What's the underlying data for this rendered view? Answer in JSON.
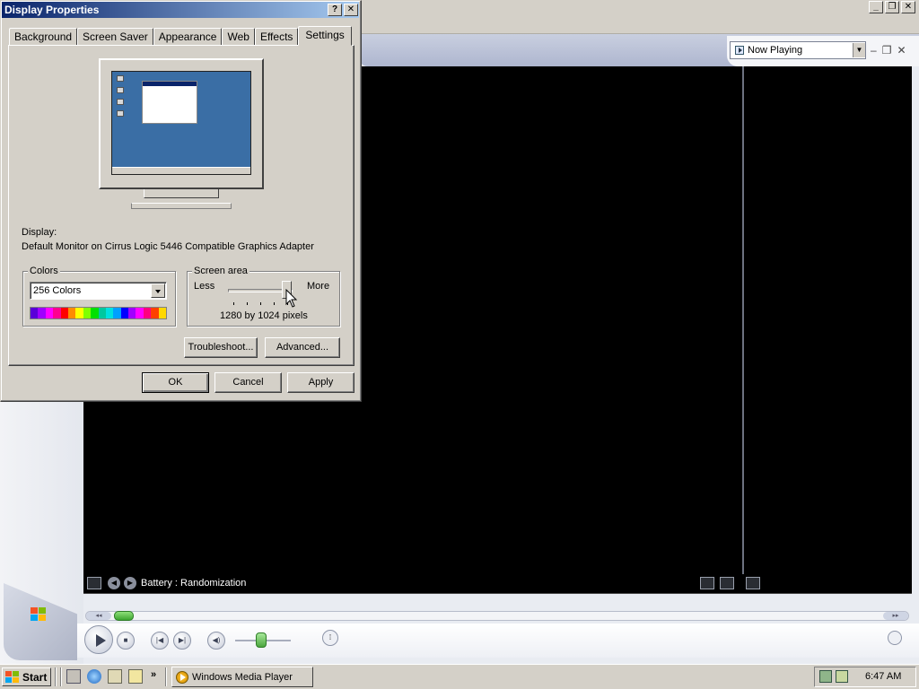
{
  "dialog": {
    "title": "Display Properties",
    "tabs": [
      "Background",
      "Screen Saver",
      "Appearance",
      "Web",
      "Effects",
      "Settings"
    ],
    "active_tab": "Settings",
    "display_label": "Display:",
    "display_value": "Default Monitor on Cirrus Logic 5446 Compatible Graphics Adapter",
    "colors": {
      "legend": "Colors",
      "selected": "256 Colors",
      "palette": [
        "#5a00d8",
        "#a000ff",
        "#ff00ff",
        "#ff0090",
        "#ff0000",
        "#ff8c00",
        "#ffff00",
        "#80ff00",
        "#00e000",
        "#00c8a0",
        "#00e0e0",
        "#00a0ff",
        "#0000ff",
        "#a000ff",
        "#ff00ff",
        "#ff0080",
        "#ff4000",
        "#ffd800"
      ]
    },
    "screen_area": {
      "legend": "Screen area",
      "less_label": "Less",
      "more_label": "More",
      "resolution_text": "1280 by 1024 pixels",
      "slider_level": 0.85
    },
    "buttons": {
      "troubleshoot": "Troubleshoot...",
      "advanced": "Advanced...",
      "ok": "OK",
      "cancel": "Cancel",
      "apply": "Apply"
    },
    "title_buttons": {
      "help": "?",
      "close": "✕"
    }
  },
  "media_player": {
    "view_select": "Now Playing",
    "now_playing_text": "Battery : Randomization",
    "seek_level": 0.02,
    "volume_level": 0.45
  },
  "taskbar": {
    "start_label": "Start",
    "task_button_label": "Windows Media Player",
    "overflow_glyph": "»",
    "clock": "6:47 AM"
  },
  "icons": [
    "help-icon",
    "close-icon",
    "minimize-icon",
    "restore-icon",
    "play-icon",
    "stop-icon",
    "previous-icon",
    "next-icon",
    "mute-icon",
    "windows-logo-icon",
    "start-flag-icon"
  ]
}
